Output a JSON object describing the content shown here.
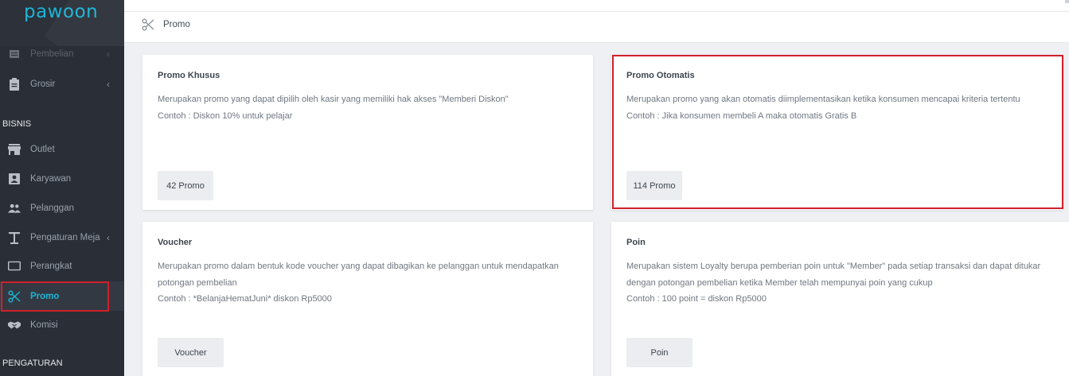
{
  "app": {
    "logo": "pawoon"
  },
  "sidebar": {
    "items": [
      {
        "label": "Pembelian",
        "icon": "list-icon",
        "chevron": "‹"
      },
      {
        "label": "Grosir",
        "icon": "clipboard-icon",
        "chevron": "‹"
      },
      {
        "label": "Outlet",
        "icon": "store-icon"
      },
      {
        "label": "Karyawan",
        "icon": "id-card-icon"
      },
      {
        "label": "Pelanggan",
        "icon": "people-icon"
      },
      {
        "label": "Pengaturan Meja",
        "icon": "table-icon",
        "chevron": "‹"
      },
      {
        "label": "Perangkat",
        "icon": "device-icon"
      },
      {
        "label": "Promo",
        "icon": "scissors-icon"
      },
      {
        "label": "Komisi",
        "icon": "handshake-icon"
      }
    ],
    "sections": {
      "bisnis": "BISNIS",
      "pengaturan": "PENGATURAN"
    },
    "active_color": "#1bb5d6"
  },
  "breadcrumb": {
    "icon": "scissors-icon",
    "label": "Promo"
  },
  "cards": [
    {
      "title": "Promo Khusus",
      "desc1": "Merupakan promo yang dapat dipilih oleh kasir yang memiliki hak akses \"Memberi Diskon\"",
      "desc2": "Contoh : Diskon 10% untuk pelajar",
      "button": "42 Promo"
    },
    {
      "title": "Promo Otomatis",
      "desc1": "Merupakan promo yang akan otomatis diimplementasikan ketika konsumen mencapai kriteria tertentu",
      "desc2": "Contoh : Jika konsumen membeli A maka otomatis Gratis B",
      "button": "114 Promo"
    },
    {
      "title": "Voucher",
      "desc1": "Merupakan promo dalam bentuk kode voucher yang dapat dibagikan ke pelanggan untuk mendapatkan potongan pembelian",
      "desc2": "Contoh : *BelanjaHematJuni* diskon Rp5000",
      "button": "Voucher"
    },
    {
      "title": "Poin",
      "desc1": "Merupakan sistem Loyalty berupa pemberian poin untuk \"Member\" pada setiap transaksi dan dapat ditukar dengan potongan pembelian ketika Member telah mempunyai poin yang cukup",
      "desc2": "Contoh : 100 point = diskon Rp5000",
      "button": "Poin"
    }
  ],
  "highlight_color": "#d0202a"
}
